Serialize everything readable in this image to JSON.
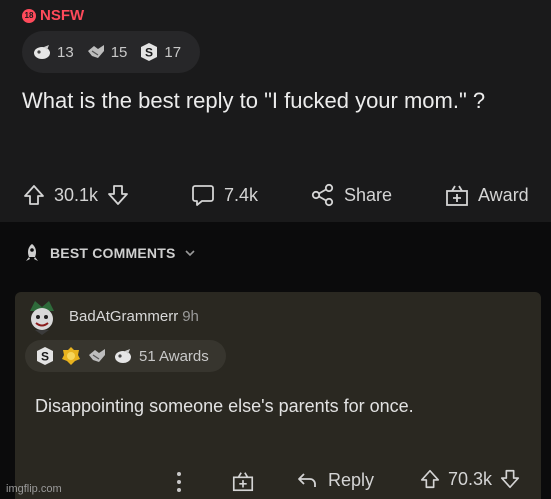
{
  "post": {
    "nsfw_label": "NSFW",
    "nsfw_badge": "18",
    "awards": [
      {
        "icon": "rocket-like-award-icon",
        "count": "13"
      },
      {
        "icon": "handshake-award-icon",
        "count": "15"
      },
      {
        "icon": "silver-award-icon",
        "count": "17"
      }
    ],
    "title": "What is the best reply to \"I fucked your mom.\" ?",
    "upvotes": "30.1k",
    "comments": "7.4k",
    "share_label": "Share",
    "award_label": "Award"
  },
  "best_comments": {
    "label": "BEST COMMENTS"
  },
  "comment": {
    "username": "BadAtGrammerr",
    "time": "9h",
    "awards_count": "51 Awards",
    "text": "Disappointing someone else's parents for once.",
    "reply_label": "Reply",
    "upvotes": "70.3k"
  },
  "watermark": "imgflip.com",
  "colors": {
    "nsfw": "#ff4a5b",
    "post_bg": "#1a1a1b",
    "comment_bg": "#2a2821",
    "page_bg": "#0b0b0c"
  }
}
